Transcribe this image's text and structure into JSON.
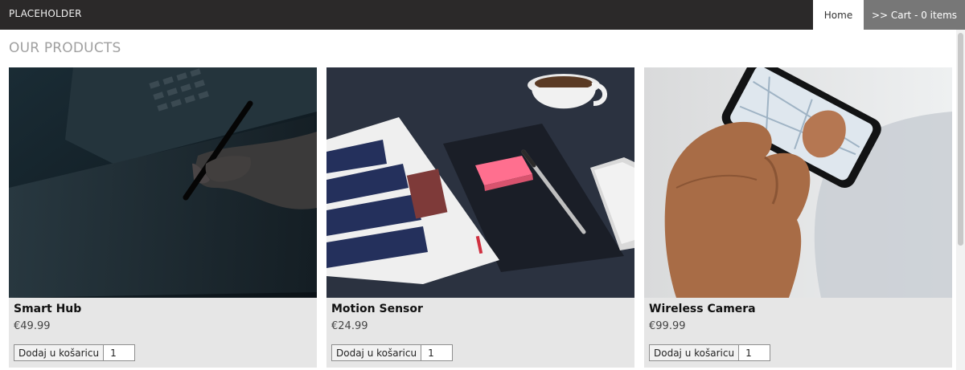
{
  "header": {
    "brand": "PLACEHOLDER",
    "nav": {
      "home_label": "Home",
      "cart_label": ">> Cart - 0 items"
    }
  },
  "section": {
    "title": "OUR PRODUCTS"
  },
  "products": [
    {
      "name": "Smart Hub",
      "price": "€49.99",
      "add_label": "Dodaj u košaricu",
      "quantity": "1",
      "image_icon": "tablet-drawing-image"
    },
    {
      "name": "Motion Sensor",
      "price": "€24.99",
      "add_label": "Dodaj u košaricu",
      "quantity": "1",
      "image_icon": "desk-notebook-image"
    },
    {
      "name": "Wireless Camera",
      "price": "€99.99",
      "add_label": "Dodaj u košaricu",
      "quantity": "1",
      "image_icon": "phone-map-image"
    }
  ],
  "colors": {
    "header_bg": "#2b2929",
    "cart_bg": "#777777",
    "card_bg": "#e6e6e6",
    "title": "#a0a0a0"
  }
}
